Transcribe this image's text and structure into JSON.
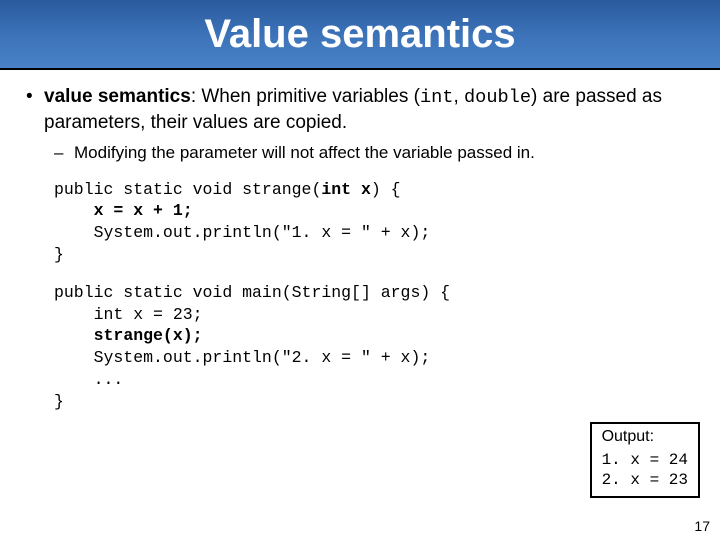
{
  "title": "Value semantics",
  "bullet": {
    "term": "value semantics",
    "before_types": ": When primitive variables (",
    "type1": "int",
    "type_sep": ", ",
    "type2": "double",
    "after_types": ") are passed as parameters, their values are copied."
  },
  "sub_bullet": "Modifying the parameter will not affect the variable passed in.",
  "code1": {
    "sig_pre": "public static void strange(",
    "sig_param": "int x",
    "sig_post": ") {",
    "l2": "    x = x + 1;",
    "l3": "    System.out.println(\"1. x = \" + x);",
    "l4": "}"
  },
  "code2": {
    "sig": "public static void main(String[] args) {",
    "l2": "    int x = 23;",
    "l3_pre": "    ",
    "l3_call": "strange(x);",
    "l4": "    System.out.println(\"2. x = \" + x);",
    "l5": "    ...",
    "l6": "}"
  },
  "output": {
    "title": "Output:",
    "line1": "1. x = 24",
    "line2": "2. x = 23"
  },
  "page_number": "17"
}
